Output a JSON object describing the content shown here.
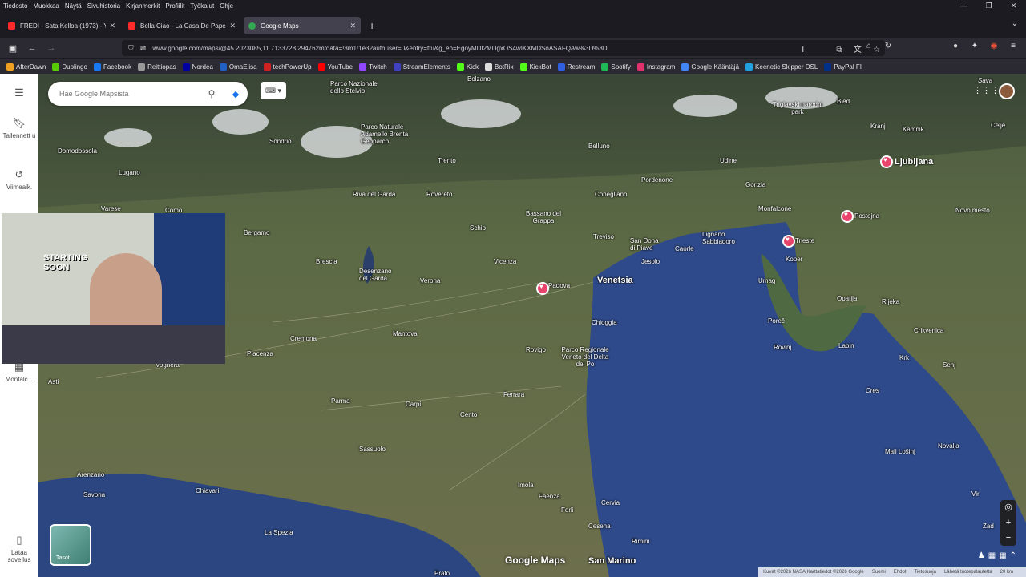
{
  "menubar": {
    "items": [
      "Tiedosto",
      "Muokkaa",
      "Näytä",
      "Sivuhistoria",
      "Kirjanmerkit",
      "Profiilit",
      "Työkalut",
      "Ohje"
    ]
  },
  "tabs": [
    {
      "title": "FREDI - Sata Kelloa (1973) - You",
      "color": "#ff2a2a"
    },
    {
      "title": "Bella Ciao - La Casa De Papel (M",
      "color": "#ff2a2a"
    },
    {
      "title": "Google Maps",
      "color": "#34a853",
      "active": true
    }
  ],
  "navbar": {
    "url": "www.google.com/maps/@45.2023085,11.7133728,294762m/data=!3m1!1e3?authuser=0&entry=ttu&g_ep=EgoyMDI2MDgxOS4wIKXMDSoASAFQAw%3D%3D"
  },
  "bookmarks": [
    {
      "label": "AfterDawn",
      "color": "#f0a020"
    },
    {
      "label": "Duolingo",
      "color": "#58cc02"
    },
    {
      "label": "Facebook",
      "color": "#1877f2"
    },
    {
      "label": "Reittiopas",
      "color": "#999999"
    },
    {
      "label": "Nordea",
      "color": "#0000a0"
    },
    {
      "label": "OmaElisa",
      "color": "#2060c0"
    },
    {
      "label": "techPowerUp",
      "color": "#d02020"
    },
    {
      "label": "YouTube",
      "color": "#ff0000"
    },
    {
      "label": "Twitch",
      "color": "#9146ff"
    },
    {
      "label": "StreamElements",
      "color": "#4040c0"
    },
    {
      "label": "Kick",
      "color": "#53fc18"
    },
    {
      "label": "BotRix",
      "color": "#dddddd"
    },
    {
      "label": "KickBot",
      "color": "#53fc18"
    },
    {
      "label": "Restream",
      "color": "#3060e0"
    },
    {
      "label": "Spotify",
      "color": "#1db954"
    },
    {
      "label": "Instagram",
      "color": "#e1306c"
    },
    {
      "label": "Google Kääntäjä",
      "color": "#4285f4"
    },
    {
      "label": "Keenetic Skipper DSL",
      "color": "#20a0e0"
    },
    {
      "label": "PayPal FI",
      "color": "#003087"
    }
  ],
  "rail": {
    "saved": "Tallennett u",
    "recent": "Viimeaik.",
    "monfalcone": "Monfalc...",
    "download": "Lataa sovellus"
  },
  "search": {
    "placeholder": "Hae Google Mapsista"
  },
  "layers_label": "Tasot",
  "map_logo": "Google Maps",
  "webcam": {
    "line1": "STARTING",
    "line2": "SOON"
  },
  "places": [
    {
      "name": "Bolzano"
    },
    {
      "name": "Parco Nazionale dello Stelvio"
    },
    {
      "name": "Parco Naturale Adamello Brenta Geoparco"
    },
    {
      "name": "Sondrio"
    },
    {
      "name": "Lugano"
    },
    {
      "name": "Domodossola"
    },
    {
      "name": "Varese"
    },
    {
      "name": "Como"
    },
    {
      "name": "Bergamo"
    },
    {
      "name": "Brescia"
    },
    {
      "name": "Trento"
    },
    {
      "name": "Riva del Garda"
    },
    {
      "name": "Rovereto"
    },
    {
      "name": "Belluno"
    },
    {
      "name": "Udine"
    },
    {
      "name": "Pordenone"
    },
    {
      "name": "Conegliano"
    },
    {
      "name": "Bassano del Grappa"
    },
    {
      "name": "Schio"
    },
    {
      "name": "Treviso"
    },
    {
      "name": "San Dona di Piave"
    },
    {
      "name": "Jesolo"
    },
    {
      "name": "Caorle"
    },
    {
      "name": "Lignano Sabbiadoro"
    },
    {
      "name": "Monfalcone"
    },
    {
      "name": "Gorizia"
    },
    {
      "name": "Trieste"
    },
    {
      "name": "Koper"
    },
    {
      "name": "Umag"
    },
    {
      "name": "Vicenza"
    },
    {
      "name": "Padova"
    },
    {
      "name": "Venetsia"
    },
    {
      "name": "Verona"
    },
    {
      "name": "Desenzano del Garda"
    },
    {
      "name": "Mantova"
    },
    {
      "name": "Cremona"
    },
    {
      "name": "Piacenza"
    },
    {
      "name": "Voghera"
    },
    {
      "name": "Asti"
    },
    {
      "name": "Parma"
    },
    {
      "name": "Carpi"
    },
    {
      "name": "Cento"
    },
    {
      "name": "Ferrara"
    },
    {
      "name": "Rovigo"
    },
    {
      "name": "Chioggia"
    },
    {
      "name": "Parco Regionale Veneto del Delta del Po"
    },
    {
      "name": "Sassuolo"
    },
    {
      "name": "Imola"
    },
    {
      "name": "Faenza"
    },
    {
      "name": "Forli"
    },
    {
      "name": "Cesena"
    },
    {
      "name": "Cervia"
    },
    {
      "name": "Rimini"
    },
    {
      "name": "San Marino"
    },
    {
      "name": "Savona"
    },
    {
      "name": "Arenzano"
    },
    {
      "name": "Chiavari"
    },
    {
      "name": "La Spezia"
    },
    {
      "name": "Prato"
    },
    {
      "name": "Ljubljana"
    },
    {
      "name": "Kranj"
    },
    {
      "name": "Kamnik"
    },
    {
      "name": "Celje"
    },
    {
      "name": "Bled"
    },
    {
      "name": "Triglavski narodni park"
    },
    {
      "name": "Postojna"
    },
    {
      "name": "Novo mesto"
    },
    {
      "name": "Opatija"
    },
    {
      "name": "Rijeka"
    },
    {
      "name": "Crikvenica"
    },
    {
      "name": "Poreč"
    },
    {
      "name": "Rovinj"
    },
    {
      "name": "Labin"
    },
    {
      "name": "Krk"
    },
    {
      "name": "Senj"
    },
    {
      "name": "Cres"
    },
    {
      "name": "Mali Lošinj"
    },
    {
      "name": "Novalja"
    },
    {
      "name": "Vir"
    },
    {
      "name": "Zad"
    },
    {
      "name": "Sava"
    }
  ],
  "attribution": [
    "Kuvat ©2026 NASA,Karttatiedot ©2026 Google",
    "Suomi",
    "Ehdot",
    "Tietosuoja",
    "Lähetä tuotepalautetta",
    "20 km"
  ]
}
